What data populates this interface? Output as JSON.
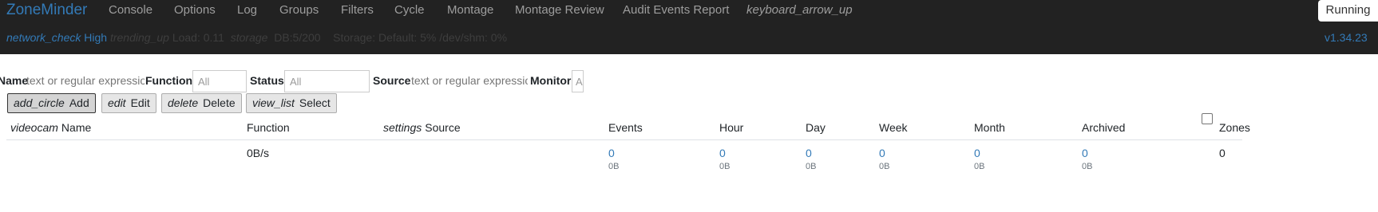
{
  "navbar": {
    "brand": "ZoneMinder",
    "items": [
      "Console",
      "Options",
      "Log",
      "Groups",
      "Filters",
      "Cycle",
      "Montage",
      "Montage Review",
      "Audit Events Report"
    ],
    "collapse_icon_text": "keyboard_arrow_up",
    "state_button": "Running",
    "status": {
      "bandwidth_icon": "network_check",
      "bandwidth": "High",
      "load_icon": "trending_up",
      "load": "Load: 0.11",
      "db_icon": "storage",
      "db": "DB:5/200",
      "storage": "Storage: Default: 5% /dev/shm: 0%"
    },
    "version": "v1.34.23"
  },
  "filters": {
    "name_label": "Name",
    "name_placeholder": "text or regular expression",
    "function_label": "Function",
    "function_value": "All",
    "status_label": "Status",
    "status_value": "All",
    "source_label": "Source",
    "source_placeholder": "text or regular expression",
    "monitor_label": "Monitor",
    "monitor_value": "All"
  },
  "toolbar": {
    "add_icon": "add_circle",
    "add_label": "Add",
    "edit_icon": "edit",
    "edit_label": "Edit",
    "delete_icon": "delete",
    "delete_label": "Delete",
    "select_icon": "view_list",
    "select_label": "Select"
  },
  "table": {
    "name_icon": "videocam",
    "settings_icon": "settings",
    "headers": [
      "Name",
      "Function",
      "Source",
      "Events",
      "Hour",
      "Day",
      "Week",
      "Month",
      "Archived",
      "Zones"
    ],
    "totals": {
      "function": "0B/s",
      "counts": [
        "0",
        "0",
        "0",
        "0",
        "0",
        "0"
      ],
      "sizes": [
        "0B",
        "0B",
        "0B",
        "0B",
        "0B",
        "0B"
      ],
      "zones": "0"
    }
  }
}
